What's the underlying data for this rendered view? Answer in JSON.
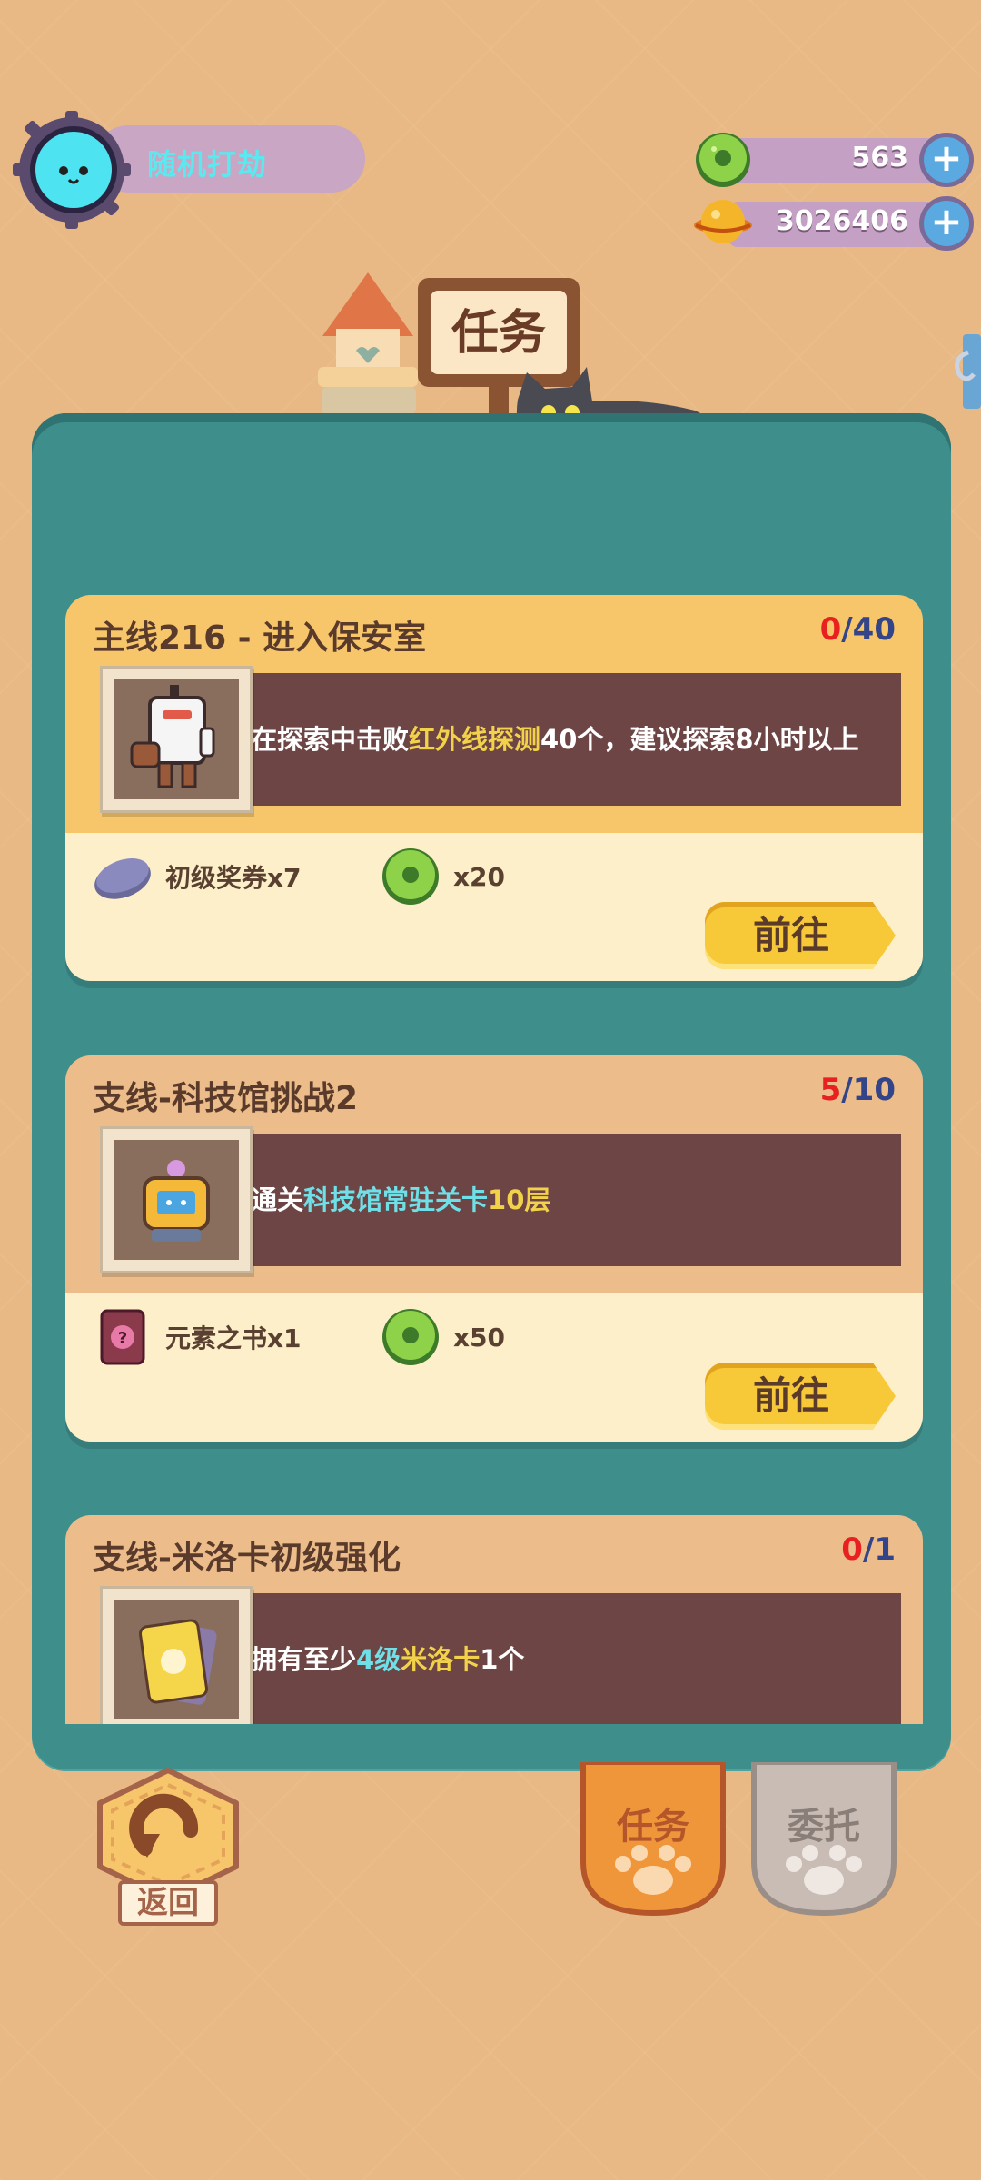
{
  "header": {
    "player_name": "随机打劫",
    "sign_title": "任务"
  },
  "currency": {
    "gems": "563",
    "gold": "3026406"
  },
  "quests": [
    {
      "title": "主线216 - 进入保安室",
      "progress_current": "0",
      "progress_total": "/40",
      "desc_parts": [
        "在探索中击败",
        "红外线探测",
        "40个，建议探索8小时以上"
      ],
      "rewards": [
        {
          "icon": "ticket-icon",
          "label": "初级奖券x7"
        },
        {
          "icon": "donut-coin-icon",
          "label": "x20"
        }
      ],
      "button": "前往"
    },
    {
      "title": "支线-科技馆挑战2",
      "progress_current": "5",
      "progress_total": "/10",
      "desc_parts": [
        "通关",
        "科技馆常驻关卡",
        "10层"
      ],
      "rewards": [
        {
          "icon": "element-book-icon",
          "label": "元素之书x1"
        },
        {
          "icon": "donut-coin-icon",
          "label": "x50"
        }
      ],
      "button": "前往"
    },
    {
      "title": "支线-米洛卡初级强化",
      "progress_current": "0",
      "progress_total": "/1",
      "desc_parts": [
        "拥有至少",
        "4级",
        "米洛卡",
        "1个"
      ]
    }
  ],
  "nav": {
    "back": "返回",
    "tasks": "任务",
    "commission": "委托"
  },
  "colors": {
    "background": "#e8b985",
    "panel": "#3e8e8c",
    "progress_current": "#e82020",
    "highlight_yellow": "#f2d24a",
    "highlight_cyan": "#6fe0e8"
  }
}
